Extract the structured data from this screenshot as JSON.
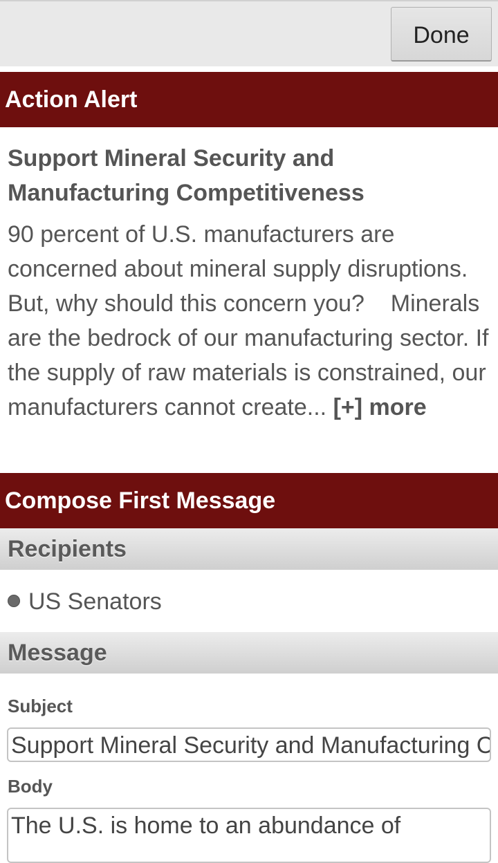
{
  "toolbar": {
    "done_label": "Done"
  },
  "action_alert": {
    "header": "Action Alert",
    "title": "Support Mineral Security and Manufacturing Competitiveness",
    "summary": "90 percent of U.S. manufacturers are concerned about mineral supply disruptions.   But, why should this concern you?    Minerals are the bedrock of our manufacturing sector. If the supply of raw materials is constrained, our manufacturers cannot create...",
    "more_label": "[+] more"
  },
  "compose": {
    "header": "Compose First Message",
    "recipients_label": "Recipients",
    "recipients": [
      "US Senators"
    ],
    "message_label": "Message",
    "subject_label": "Subject",
    "subject_value": "Support Mineral Security and Manufacturing Competitiveness",
    "body_label": "Body",
    "body_value": "The U.S. is home to an abundance of"
  }
}
